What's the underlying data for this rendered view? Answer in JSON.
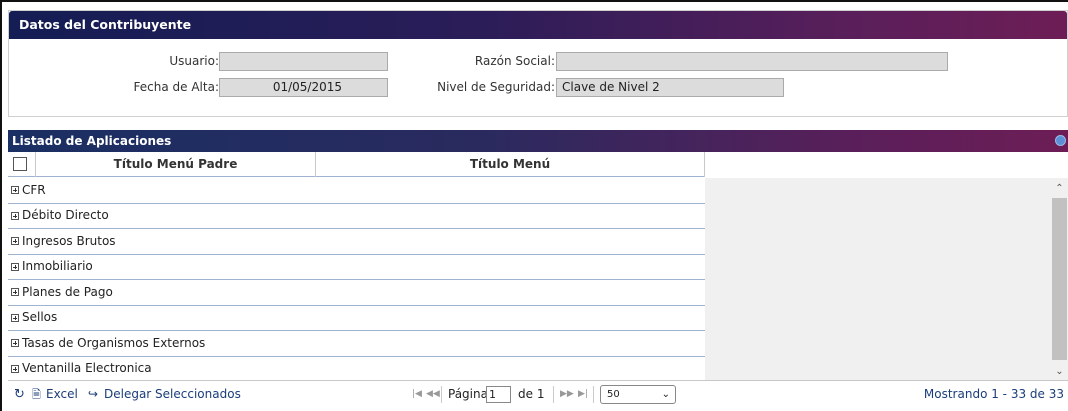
{
  "contribuyente": {
    "title": "Datos del Contribuyente",
    "usuario_label": "Usuario:",
    "usuario_value": "",
    "razon_social_label": "Razón Social:",
    "razon_social_value": "",
    "fecha_alta_label": "Fecha de Alta:",
    "fecha_alta_value": "01/05/2015",
    "nivel_seguridad_label": "Nivel de Seguridad:",
    "nivel_seguridad_value": "Clave de Nivel 2"
  },
  "listado": {
    "title": "Listado de Aplicaciones",
    "columns": [
      "Título Menú Padre",
      "Título Menú"
    ],
    "groups": [
      "CFR",
      "Débito Directo",
      "Ingresos Brutos",
      "Inmobiliario",
      "Planes de Pago",
      "Sellos",
      "Tasas de Organismos Externos",
      "Ventanilla Electronica"
    ]
  },
  "pager": {
    "excel_label": "Excel",
    "delegar_label": "Delegar Seleccionados",
    "page_label": "Página",
    "page_value": "1",
    "of_label": "de 1",
    "page_size": "50",
    "showing": "Mostrando 1 - 33 de 33"
  },
  "colors": {
    "header_start": "#141d54",
    "header_end": "#6d1d55",
    "row_border": "#9fb3d1",
    "link": "#1a3d7a"
  },
  "icons": {
    "refresh": "refresh-icon",
    "excel": "file-icon",
    "delegar": "share-icon",
    "expand": "plus-box-icon"
  }
}
